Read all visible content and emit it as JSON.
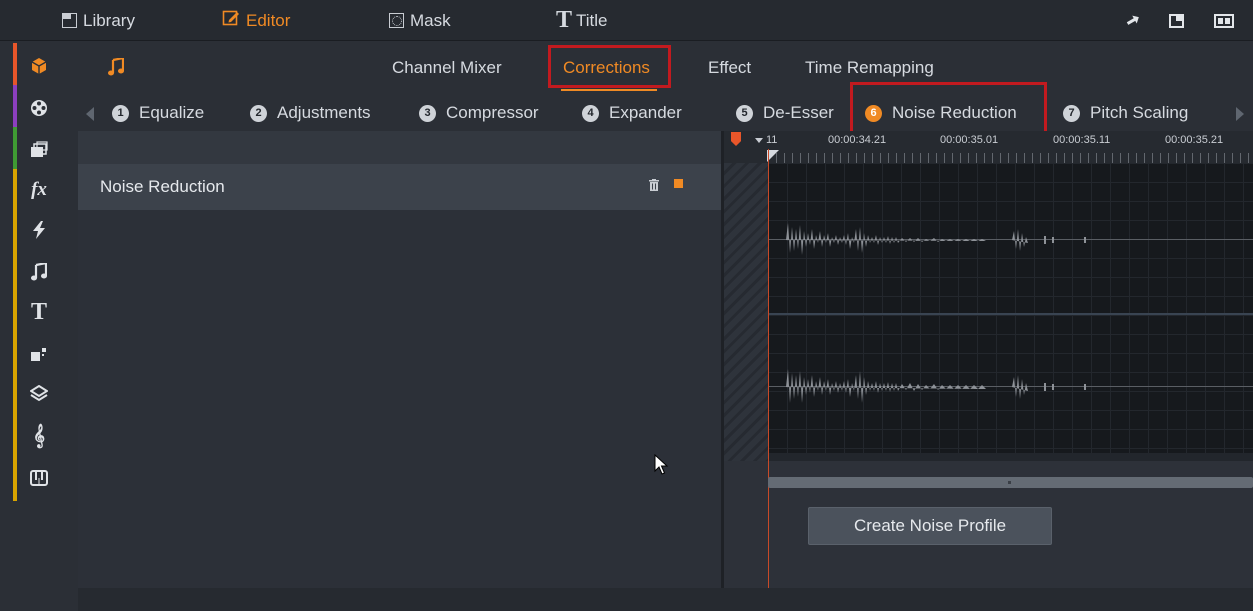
{
  "top_tabs": {
    "library": "Library",
    "editor": "Editor",
    "mask": "Mask",
    "title": "Title"
  },
  "sub_tabs": [
    "Channel Mixer",
    "Corrections",
    "Effect",
    "Time Remapping"
  ],
  "active_sub_tab": "Corrections",
  "steps": [
    {
      "num": "1",
      "label": "Equalize"
    },
    {
      "num": "2",
      "label": "Adjustments"
    },
    {
      "num": "3",
      "label": "Compressor"
    },
    {
      "num": "4",
      "label": "Expander"
    },
    {
      "num": "5",
      "label": "De-Esser"
    },
    {
      "num": "6",
      "label": "Noise Reduction"
    },
    {
      "num": "7",
      "label": "Pitch Scaling"
    }
  ],
  "active_step": "Noise Reduction",
  "effect_list": {
    "item": "Noise Reduction"
  },
  "timeline": {
    "start_frame": "11",
    "timecodes": [
      "00:00:34.21",
      "00:00:35.01",
      "00:00:35.11",
      "00:00:35.21"
    ]
  },
  "create_button": "Create Noise Profile",
  "colors": {
    "accent": "#f08a24",
    "highlight": "#c21a1f",
    "playhead": "#e8562a"
  },
  "icons": {
    "library": "list-icon",
    "editor": "edit-icon",
    "mask": "mask-icon",
    "title": "title-T-icon",
    "audio": "music-note-icon"
  }
}
